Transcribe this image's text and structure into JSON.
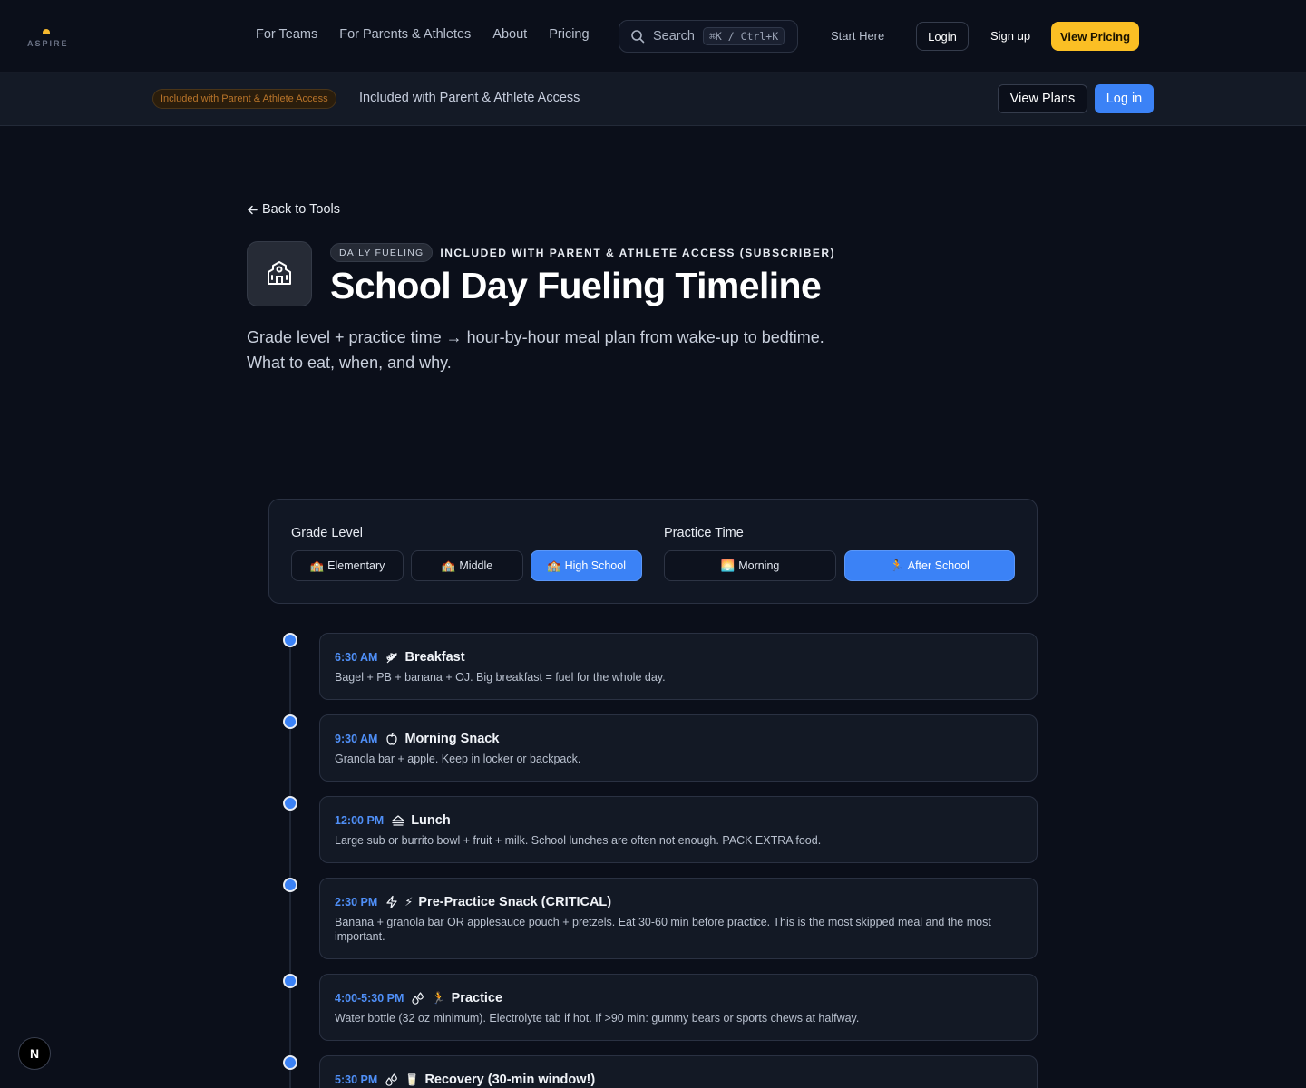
{
  "nav": {
    "logo_text": "ASPIRE",
    "links": [
      "For Teams",
      "For Parents & Athletes",
      "About",
      "Pricing"
    ],
    "search": {
      "label": "Search",
      "shortcut": "⌘K / Ctrl+K"
    },
    "start_here": "Start Here",
    "login": "Login",
    "signup": "Sign up",
    "view_pricing": "View Pricing",
    "accent": "#fbbf24"
  },
  "subbar": {
    "pill": "Included with Parent & Athlete Access",
    "text": "Included with Parent & Athlete Access",
    "view_plans": "View Plans",
    "log_in": "Log in",
    "accent": "#3b82f6"
  },
  "hero": {
    "back": "Back to Tools",
    "tag": "DAILY FUELING",
    "access": "INCLUDED WITH PARENT & ATHLETE ACCESS (SUBSCRIBER)",
    "title": "School Day Fueling Timeline",
    "description": "Grade level + practice time → hour-by-hour meal plan from wake-up to bedtime. What to eat, when, and why.",
    "icon": "school-icon"
  },
  "controls": {
    "grade_label": "Grade Level",
    "grades": [
      {
        "label": "Elementary",
        "emoji": "🏫",
        "active": false
      },
      {
        "label": "Middle",
        "emoji": "🏫",
        "active": false
      },
      {
        "label": "High School",
        "emoji": "🏫",
        "active": true
      }
    ],
    "practice_label": "Practice Time",
    "practice": [
      {
        "label": "Morning",
        "emoji": "🌅",
        "active": false
      },
      {
        "label": "After School",
        "emoji": "🏃",
        "active": true
      }
    ]
  },
  "timeline": [
    {
      "time": "6:30 AM",
      "icon": "wheat-icon",
      "emoji": "",
      "title": "Breakfast",
      "desc": "Bagel + PB + banana + OJ. Big breakfast = fuel for the whole day."
    },
    {
      "time": "9:30 AM",
      "icon": "apple-icon",
      "emoji": "",
      "title": "Morning Snack",
      "desc": "Granola bar + apple. Keep in locker or backpack."
    },
    {
      "time": "12:00 PM",
      "icon": "sandwich-icon",
      "emoji": "",
      "title": "Lunch",
      "desc": "Large sub or burrito bowl + fruit + milk. School lunches are often not enough. PACK EXTRA food."
    },
    {
      "time": "2:30 PM",
      "icon": "zap-icon",
      "emoji": "⚡",
      "title": "Pre-Practice Snack (CRITICAL)",
      "desc": "Banana + granola bar OR applesauce pouch + pretzels. Eat 30-60 min before practice. This is the most skipped meal and the most important."
    },
    {
      "time": "4:00-5:30 PM",
      "icon": "droplets-icon",
      "emoji": "🏃",
      "title": "Practice",
      "desc": "Water bottle (32 oz minimum). Electrolyte tab if hot. If >90 min: gummy bears or sports chews at halfway."
    },
    {
      "time": "5:30 PM",
      "icon": "droplets-icon",
      "emoji": "🥛",
      "title": "Recovery (30-min window!)",
      "desc": ""
    }
  ],
  "badge": "N"
}
